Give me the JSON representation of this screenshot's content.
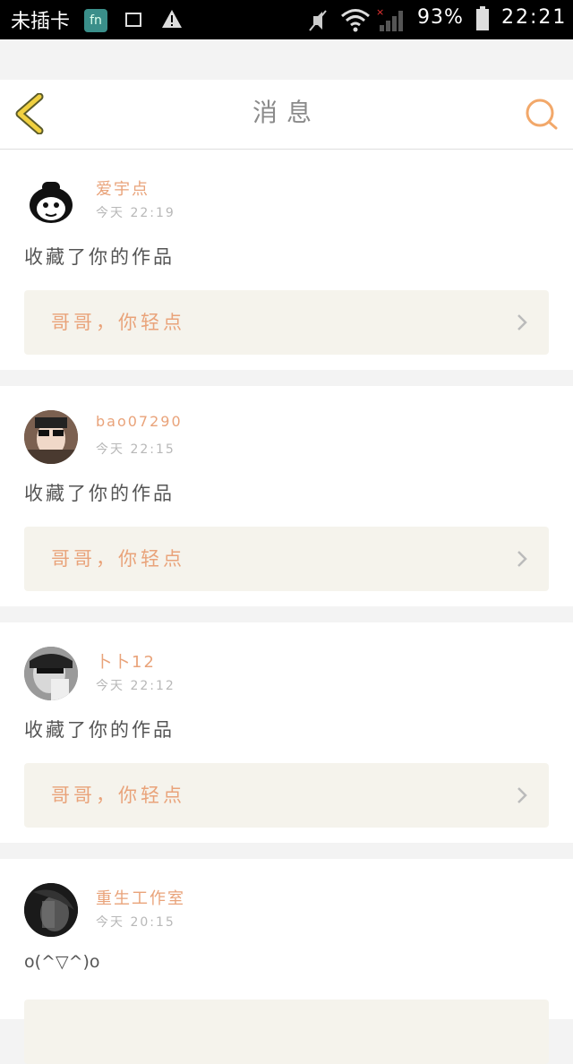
{
  "status_bar": {
    "carrier": "未插卡",
    "app_icon_glyph": "fn",
    "battery_percent": "93%",
    "time": "22:21",
    "icons": [
      "app-icon",
      "image-icon",
      "warning-icon",
      "mute-icon",
      "wifi-icon",
      "signal-icon",
      "battery-icon"
    ]
  },
  "navbar": {
    "title": "消息",
    "back_icon": "chevron-left-icon",
    "search_icon": "search-icon"
  },
  "colors": {
    "accent": "#e9a37a",
    "back_arrow": "#f0d040",
    "search_ring": "#f2a86a",
    "work_box_bg": "#f5f3ec",
    "divider": "#f3f3f3"
  },
  "messages": [
    {
      "username": "爱宇点",
      "time": "今天 22:19",
      "action": "收藏了你的作品",
      "work_title": "哥哥，你轻点"
    },
    {
      "username": "bao07290",
      "time": "今天 22:15",
      "action": "收藏了你的作品",
      "work_title": "哥哥，你轻点"
    },
    {
      "username": "卜卜12",
      "time": "今天 22:12",
      "action": "收藏了你的作品",
      "work_title": "哥哥，你轻点"
    },
    {
      "username": "重生工作室",
      "time": "今天 20:15",
      "action": "o(^▽^)o",
      "work_title": ""
    }
  ]
}
